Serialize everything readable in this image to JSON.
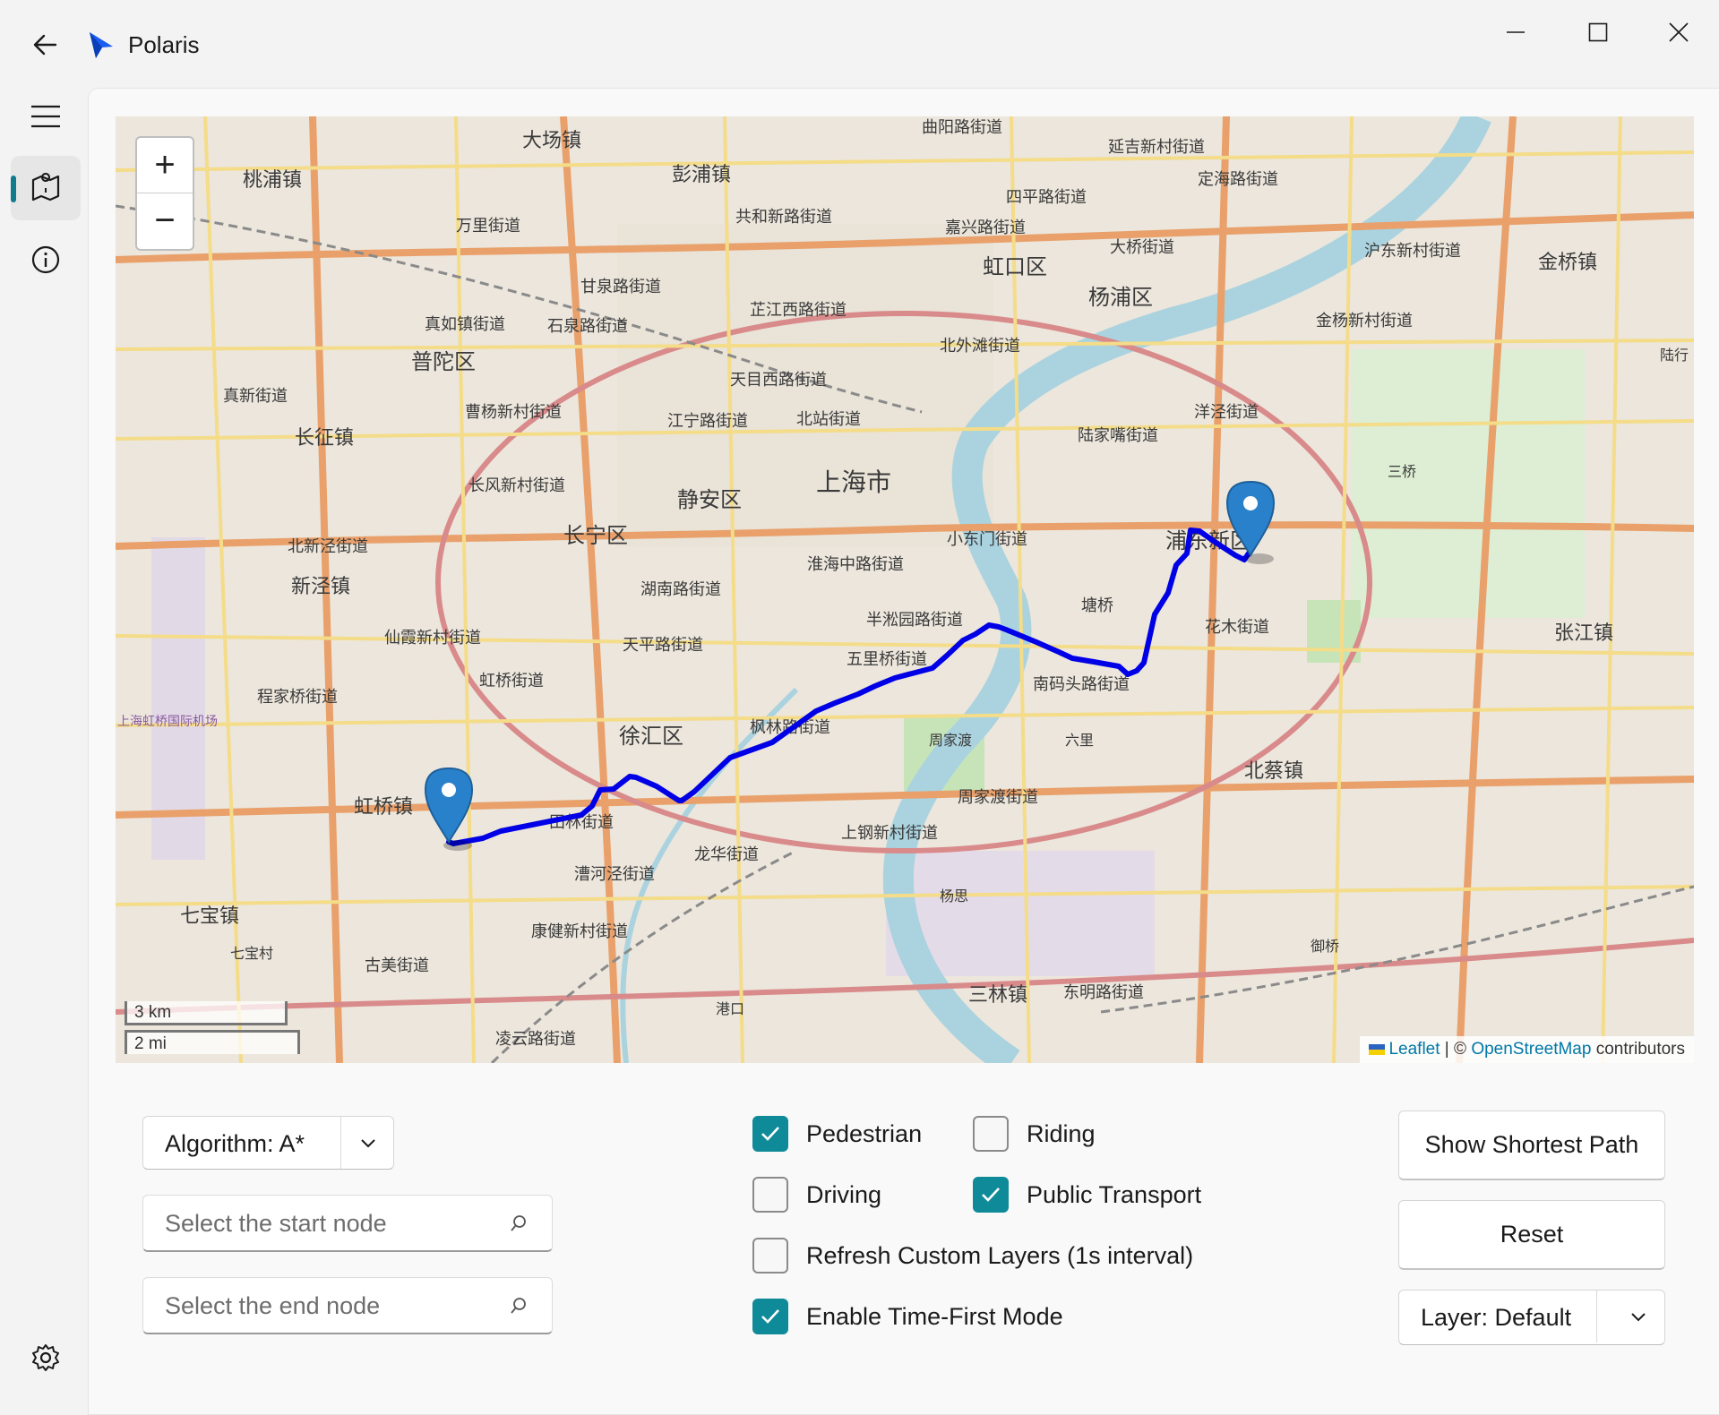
{
  "window": {
    "title": "Polaris",
    "colors": {
      "accent": "#0f8a99",
      "route": "#0000e6",
      "marker": "#2a81cb"
    }
  },
  "nav": {
    "items": [
      {
        "icon": "hamburger-menu-icon"
      },
      {
        "icon": "map-route-icon",
        "selected": true
      },
      {
        "icon": "info-icon"
      }
    ],
    "footer_icon": "gear-icon"
  },
  "map": {
    "zoom_in": "+",
    "zoom_out": "−",
    "scale_metric": "3 km",
    "scale_imperial": "2 mi",
    "attribution": {
      "leaflet": "Leaflet",
      "separator": " | © ",
      "osm": "OpenStreetMap",
      "suffix": " contributors"
    },
    "labels": [
      "大场镇",
      "曲阳路街道",
      "延吉新村街道",
      "彭浦镇",
      "桃浦镇",
      "定海路街道",
      "共和新路街道",
      "四平路街道",
      "万里街道",
      "嘉兴路街道",
      "大桥街道",
      "虹口区",
      "杨浦区",
      "沪东新村街道",
      "金桥镇",
      "甘泉路街道",
      "芷江西路街道",
      "真如镇街道",
      "石泉路街道",
      "金杨新村街道",
      "普陀区",
      "北外滩街道",
      "天目西路街道",
      "真新街道",
      "曹杨新村街道",
      "江宁路街道",
      "北站街道",
      "洋泾街道",
      "陆家嘴街道",
      "长征镇",
      "上海市",
      "长风新村街道",
      "静安区",
      "长宁区",
      "小东门街道",
      "浦东新区",
      "北新泾街道",
      "淮海中路街道",
      "新泾镇",
      "湖南路街道",
      "塘桥",
      "半淞园路街道",
      "花木街道",
      "仙霞新村街道",
      "天平路街道",
      "张江镇",
      "五里桥街道",
      "南码头路街道",
      "虹桥街道",
      "程家桥街道",
      "枫林路街道",
      "徐汇区",
      "周家渡",
      "六里",
      "北蔡镇",
      "上海虹桥国际机场",
      "虹桥镇",
      "周家渡街道",
      "田林街道",
      "上钢新村街道",
      "龙华街道",
      "漕河泾街道",
      "杨思",
      "七宝镇",
      "康健新村街道",
      "七宝村",
      "古美街道",
      "三林镇",
      "东明路街道",
      "港口",
      "凌云路街道",
      "御桥",
      "三桥",
      "陆行"
    ]
  },
  "controls": {
    "algorithm_label": "Algorithm: A*",
    "start_placeholder": "Select the start node",
    "end_placeholder": "Select the end node",
    "checkboxes": [
      {
        "label": "Pedestrian",
        "checked": true
      },
      {
        "label": "Riding",
        "checked": false
      },
      {
        "label": "Driving",
        "checked": false
      },
      {
        "label": "Public Transport",
        "checked": true
      },
      {
        "label": "Refresh Custom Layers (1s interval)",
        "checked": false
      },
      {
        "label": "Enable Time-First Mode",
        "checked": true
      }
    ],
    "show_path_label": "Show Shortest Path",
    "reset_label": "Reset",
    "layer_label": "Layer: Default"
  }
}
